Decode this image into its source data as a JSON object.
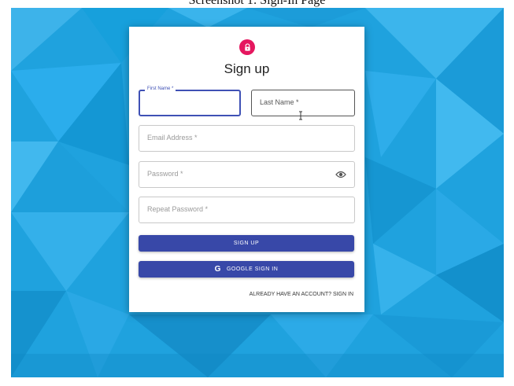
{
  "caption": "Screenshot 1: Sign-In Page",
  "form": {
    "title": "Sign up",
    "first_name_label": "First Name *",
    "last_name_placeholder": "Last Name *",
    "email_placeholder": "Email Address *",
    "password_placeholder": "Password *",
    "repeat_password_placeholder": "Repeat Password *",
    "sign_up_label": "SIGN UP",
    "google_label": "GOOGLE SIGN IN",
    "google_icon_glyph": "G",
    "signin_link": "ALREADY HAVE AN ACCOUNT? SIGN IN"
  },
  "icons": {
    "lock": "lock-icon",
    "eye": "eye-icon",
    "google": "google-icon",
    "cursor": "text-cursor-icon"
  },
  "colors": {
    "accent": "#3848a8",
    "lock_badge": "#e5175f",
    "background": "#1fa2de"
  }
}
